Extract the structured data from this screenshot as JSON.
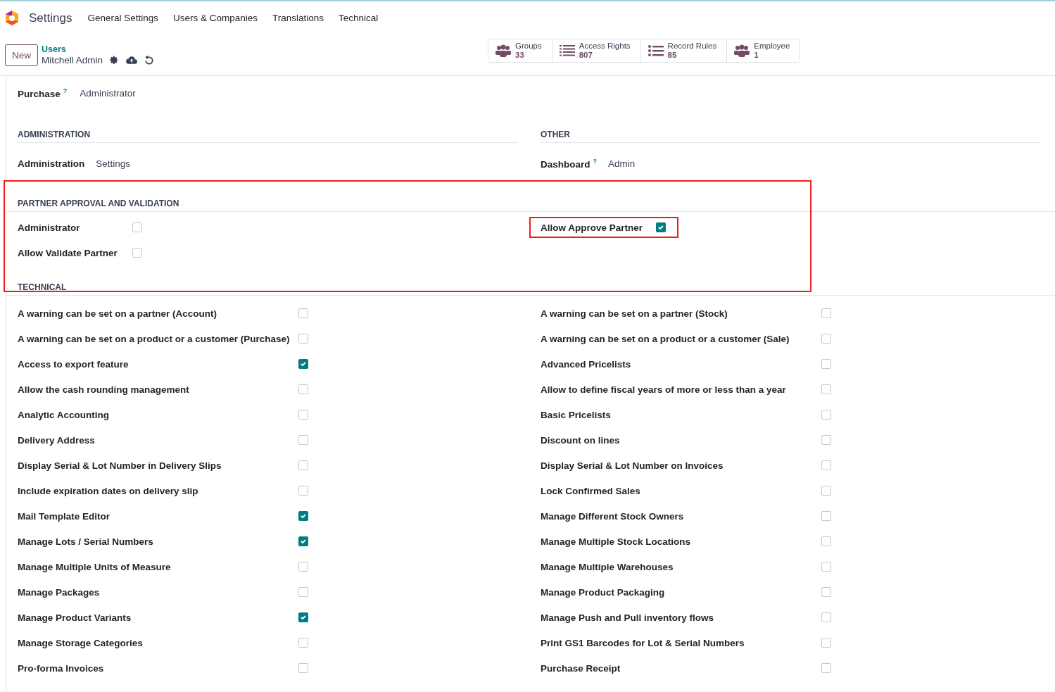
{
  "navbar": {
    "app": "Settings",
    "menu": [
      "General Settings",
      "Users & Companies",
      "Translations",
      "Technical"
    ]
  },
  "control_panel": {
    "new_button": "New",
    "breadcrumb": "Users",
    "record": "Mitchell Admin",
    "smart_buttons": [
      {
        "kind": "users",
        "label": "Groups",
        "count": "33"
      },
      {
        "kind": "list",
        "label": "Access Rights",
        "count": "807"
      },
      {
        "kind": "bullets",
        "label": "Record Rules",
        "count": "85"
      },
      {
        "kind": "users",
        "label": "Employee",
        "count": "1"
      }
    ]
  },
  "purchase": {
    "label": "Purchase",
    "help": "?",
    "value": "Administrator"
  },
  "administration": {
    "title": "ADMINISTRATION",
    "label": "Administration",
    "value": "Settings"
  },
  "other": {
    "title": "OTHER",
    "label": "Dashboard",
    "help": "?",
    "value": "Admin"
  },
  "partner_section": {
    "title": "PARTNER APPROVAL AND VALIDATION",
    "highlighted": true,
    "left": [
      {
        "label": "Administrator",
        "checked": false
      },
      {
        "label": "Allow Validate Partner",
        "checked": false
      }
    ],
    "right": [
      {
        "label": "Allow Approve Partner",
        "checked": true,
        "highlighted": true
      }
    ]
  },
  "technical": {
    "title": "TECHNICAL",
    "rows": [
      [
        {
          "label": "A warning can be set on a partner (Account)",
          "checked": false
        },
        {
          "label": "A warning can be set on a partner (Stock)",
          "checked": false
        }
      ],
      [
        {
          "label": "A warning can be set on a product or a customer (Purchase)",
          "checked": false
        },
        {
          "label": "A warning can be set on a product or a customer (Sale)",
          "checked": false
        }
      ],
      [
        {
          "label": "Access to export feature",
          "checked": true
        },
        {
          "label": "Advanced Pricelists",
          "checked": false
        }
      ],
      [
        {
          "label": "Allow the cash rounding management",
          "checked": false
        },
        {
          "label": "Allow to define fiscal years of more or less than a year",
          "checked": false
        }
      ],
      [
        {
          "label": "Analytic Accounting",
          "checked": false
        },
        {
          "label": "Basic Pricelists",
          "checked": false
        }
      ],
      [
        {
          "label": "Delivery Address",
          "checked": false
        },
        {
          "label": "Discount on lines",
          "checked": false
        }
      ],
      [
        {
          "label": "Display Serial & Lot Number in Delivery Slips",
          "checked": false
        },
        {
          "label": "Display Serial & Lot Number on Invoices",
          "checked": false
        }
      ],
      [
        {
          "label": "Include expiration dates on delivery slip",
          "checked": false
        },
        {
          "label": "Lock Confirmed Sales",
          "checked": false
        }
      ],
      [
        {
          "label": "Mail Template Editor",
          "checked": true
        },
        {
          "label": "Manage Different Stock Owners",
          "checked": false
        }
      ],
      [
        {
          "label": "Manage Lots / Serial Numbers",
          "checked": true
        },
        {
          "label": "Manage Multiple Stock Locations",
          "checked": false
        }
      ],
      [
        {
          "label": "Manage Multiple Units of Measure",
          "checked": false
        },
        {
          "label": "Manage Multiple Warehouses",
          "checked": false
        }
      ],
      [
        {
          "label": "Manage Packages",
          "checked": false
        },
        {
          "label": "Manage Product Packaging",
          "checked": false
        }
      ],
      [
        {
          "label": "Manage Product Variants",
          "checked": true
        },
        {
          "label": "Manage Push and Pull inventory flows",
          "checked": false
        }
      ],
      [
        {
          "label": "Manage Storage Categories",
          "checked": false
        },
        {
          "label": "Print GS1 Barcodes for Lot & Serial Numbers",
          "checked": false
        }
      ],
      [
        {
          "label": "Pro-forma Invoices",
          "checked": false
        },
        {
          "label": "Purchase Receipt",
          "checked": false
        }
      ]
    ]
  }
}
